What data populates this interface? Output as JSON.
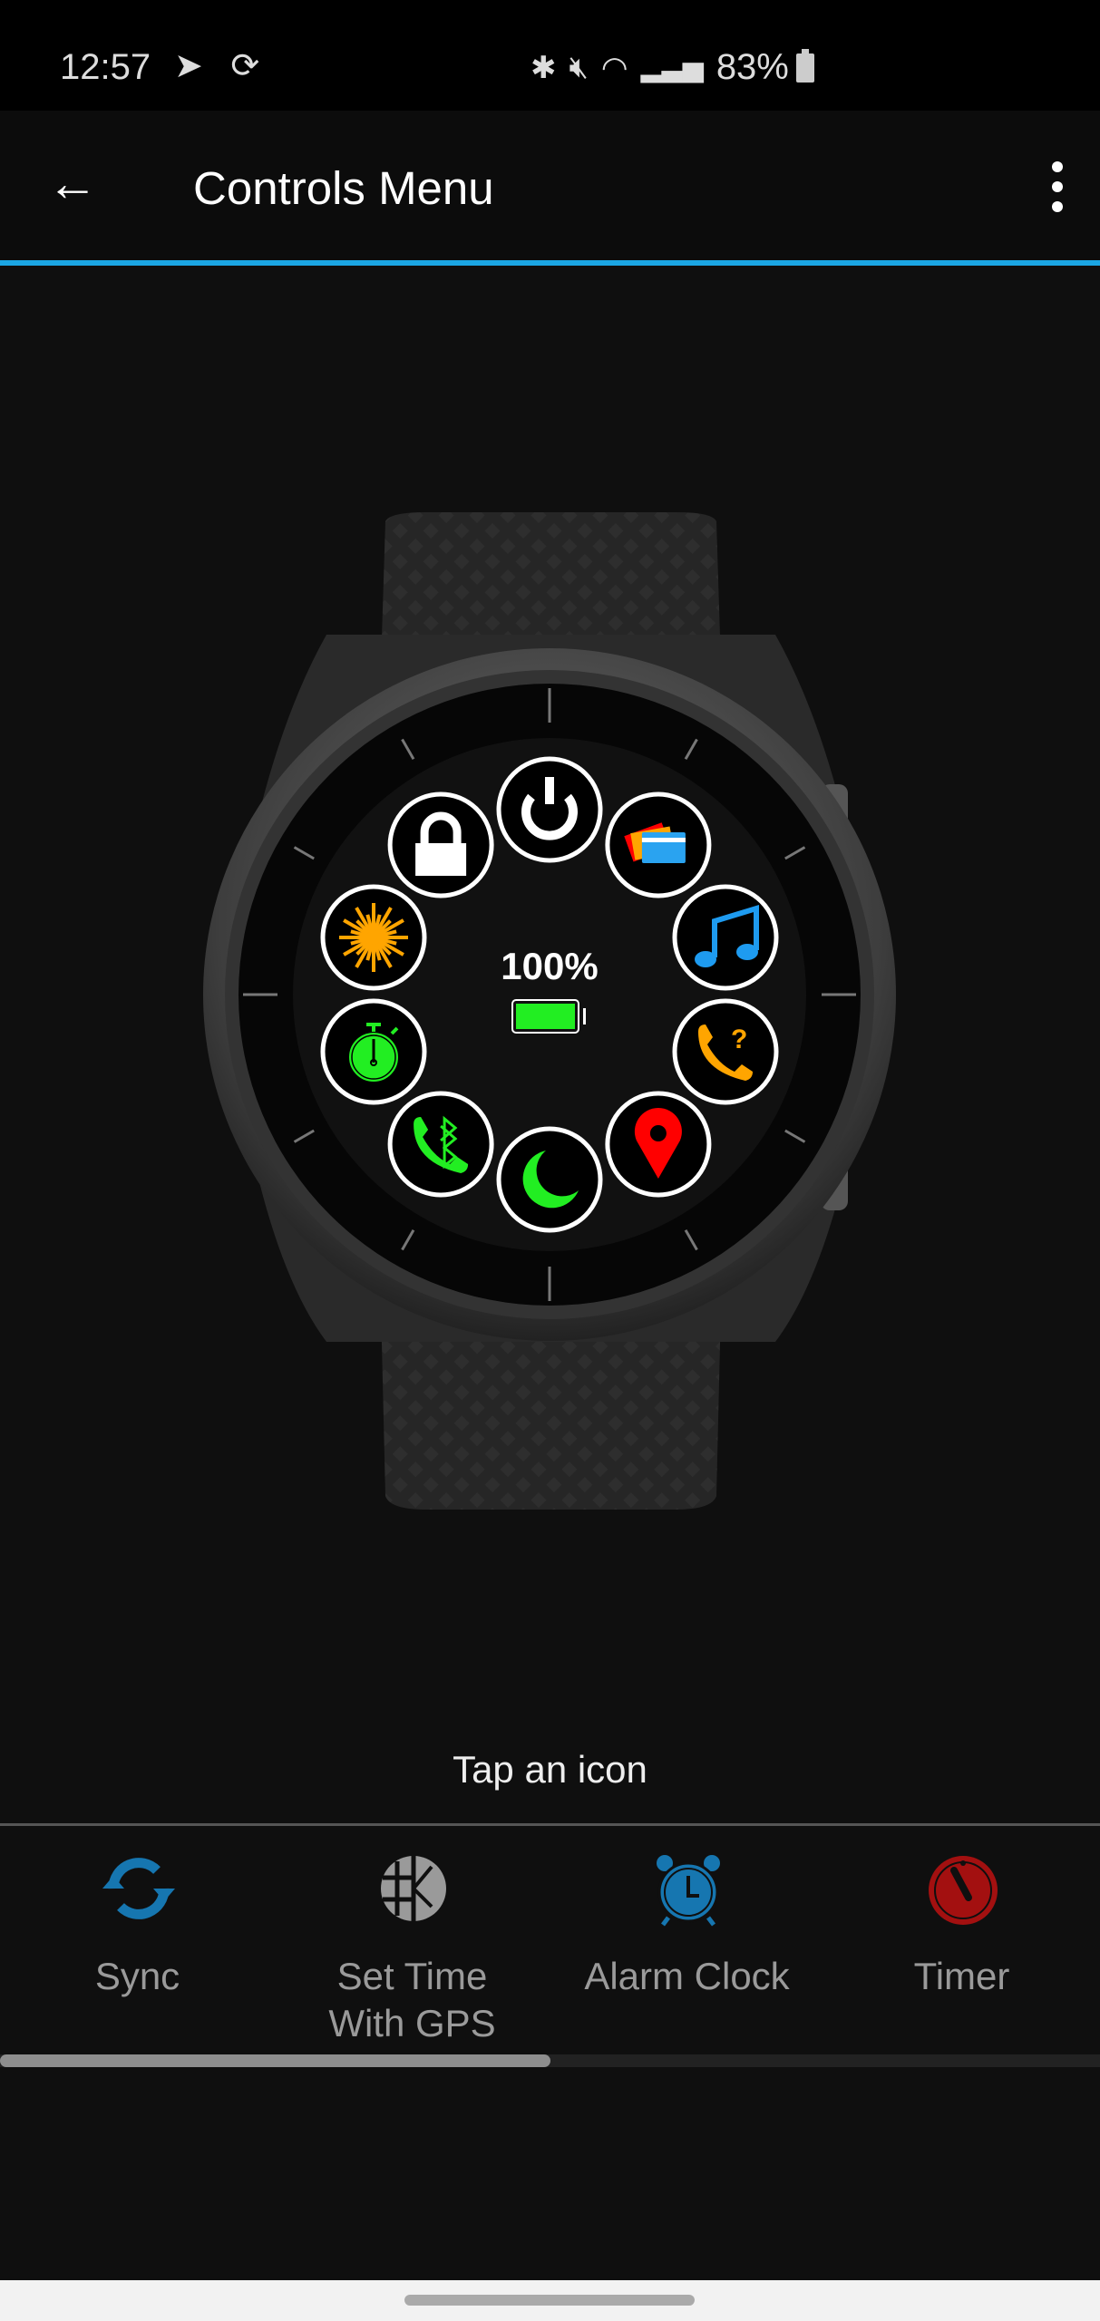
{
  "status_bar": {
    "time": "12:57",
    "left_icons": [
      "telegram-icon",
      "sync-icon"
    ],
    "right_icons": [
      "bluetooth-icon",
      "mute-icon",
      "wifi-icon",
      "signal-icon"
    ],
    "battery": "83%"
  },
  "app_bar": {
    "title": "Controls Menu",
    "back_icon": "arrow-left-icon",
    "menu_icon": "more-vert-icon",
    "accent": "#1ba6e4"
  },
  "watch": {
    "battery_percent": "100%",
    "battery_level": 1.0,
    "controls": [
      {
        "name": "power",
        "icon": "power-icon",
        "color": "#ffffff"
      },
      {
        "name": "wallet",
        "icon": "wallet-cards-icon",
        "color": "#2aa3f0"
      },
      {
        "name": "music",
        "icon": "music-note-icon",
        "color": "#1e9bf0"
      },
      {
        "name": "find-phone",
        "icon": "phone-question-icon",
        "color": "#ffa500"
      },
      {
        "name": "save-location",
        "icon": "map-pin-icon",
        "color": "#ff0000"
      },
      {
        "name": "sleep",
        "icon": "moon-icon",
        "color": "#22ee22"
      },
      {
        "name": "phone-connection",
        "icon": "phone-bluetooth-icon",
        "color": "#22ee22"
      },
      {
        "name": "stopwatch",
        "icon": "stopwatch-icon",
        "color": "#22ee22"
      },
      {
        "name": "brightness",
        "icon": "sun-icon",
        "color": "#ffa500"
      },
      {
        "name": "lock",
        "icon": "lock-icon",
        "color": "#ffffff"
      }
    ]
  },
  "hint": "Tap an icon",
  "actions": [
    {
      "label": "Sync",
      "icon": "sync-icon",
      "color": "#1676b0"
    },
    {
      "label": "Set Time\nWith GPS",
      "line1": "Set Time",
      "line2": "With GPS",
      "icon": "globe-clock-icon",
      "color": "#9a9a9a"
    },
    {
      "label": "Alarm Clock",
      "icon": "alarm-clock-icon",
      "color": "#1676b0"
    },
    {
      "label": "Timer",
      "icon": "timer-icon",
      "color": "#a31010"
    }
  ],
  "scroll_progress": 0.5
}
